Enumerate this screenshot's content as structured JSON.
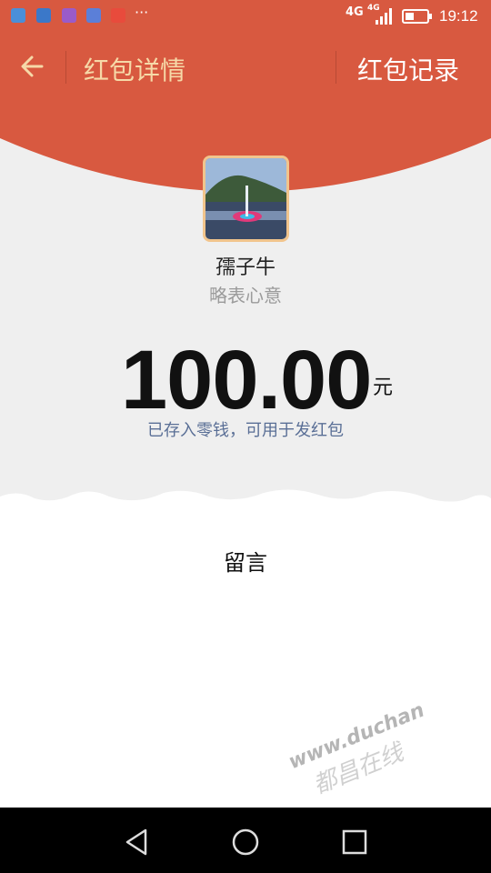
{
  "status_bar": {
    "time": "19:12",
    "network": "4G",
    "network_small": "4G",
    "more": "···"
  },
  "header": {
    "title": "红包详情",
    "record_label": "红包记录"
  },
  "sender": {
    "name": "孺子牛",
    "greeting": "略表心意"
  },
  "amount": {
    "value": "100.00",
    "currency": "元"
  },
  "notice": "已存入零钱，可用于发红包",
  "message_label": "留言",
  "watermark": {
    "url": "www.duchan",
    "text": "都昌在线"
  },
  "colors": {
    "accent": "#d85940",
    "gold": "#f6d9a8",
    "gray_bg": "#efefef",
    "notice": "#5a6f96"
  },
  "icons": [
    "wifi-hotspot-icon",
    "chat-icon",
    "gallery-icon",
    "paw-icon",
    "video-icon",
    "signal-icon",
    "battery-icon",
    "back-arrow-icon",
    "nav-back-icon",
    "nav-home-icon",
    "nav-recent-icon"
  ]
}
